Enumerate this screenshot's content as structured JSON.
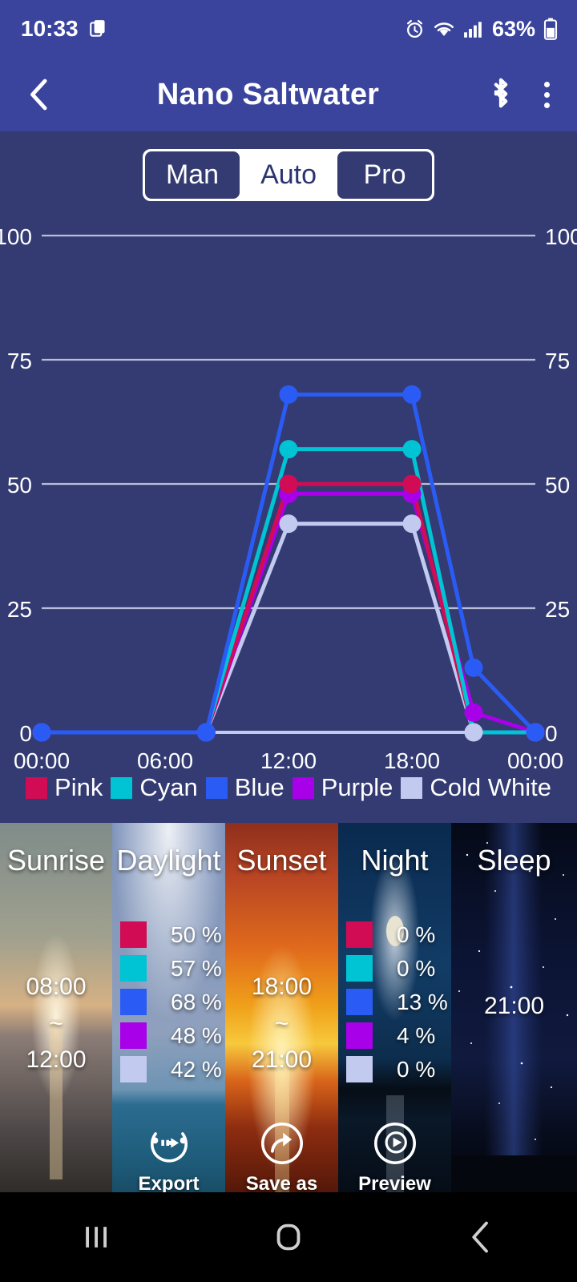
{
  "status_bar": {
    "time": "10:33",
    "battery_percent": "63%",
    "icons": [
      "screen-record-icon",
      "alarm-icon",
      "wifi-icon",
      "signal-icon",
      "battery-icon"
    ]
  },
  "app_bar": {
    "title": "Nano Saltwater",
    "back_icon": "back-chevron-icon",
    "bluetooth_icon": "bluetooth-icon",
    "overflow_icon": "kebab-menu-icon"
  },
  "mode_selector": {
    "options": [
      "Man",
      "Auto",
      "Pro"
    ],
    "selected": "Auto"
  },
  "colors": {
    "panel_bg": "#333b72",
    "app_bar_bg": "#3a449c",
    "pink": "#d10c54",
    "cyan": "#00c3d4",
    "blue": "#2a5cf5",
    "purple": "#a800e8",
    "cold_white": "#c3caf0",
    "grid": "#b9bed8",
    "axis_text": "#ffffff"
  },
  "chart_data": {
    "type": "line",
    "title": "",
    "xlabel": "",
    "ylabel": "",
    "ylim": [
      0,
      100
    ],
    "yticks": [
      0,
      25,
      50,
      75,
      100
    ],
    "ytick_labels_left": [
      "0",
      "25",
      "50",
      "75",
      "100"
    ],
    "ytick_labels_right": [
      "0",
      "25",
      "50",
      "75",
      "100"
    ],
    "xticks": [
      "00:00",
      "06:00",
      "12:00",
      "18:00",
      "00:00"
    ],
    "xlim_hours": [
      0,
      24
    ],
    "grid": true,
    "legend_position": "bottom",
    "x_points_hours": [
      0,
      8,
      12,
      18,
      21,
      24
    ],
    "series": [
      {
        "name": "Pink",
        "color": "#d10c54",
        "values": [
          0,
          0,
          50,
          50,
          0,
          0
        ]
      },
      {
        "name": "Cyan",
        "color": "#00c3d4",
        "values": [
          0,
          0,
          57,
          57,
          0,
          0
        ]
      },
      {
        "name": "Blue",
        "color": "#2a5cf5",
        "values": [
          0,
          0,
          68,
          68,
          13,
          0
        ]
      },
      {
        "name": "Purple",
        "color": "#a800e8",
        "values": [
          0,
          0,
          48,
          48,
          4,
          0
        ]
      },
      {
        "name": "Cold White",
        "color": "#c3caf0",
        "values": [
          0,
          0,
          42,
          42,
          0,
          0
        ]
      }
    ]
  },
  "legend": [
    {
      "label": "Pink",
      "color": "#d10c54"
    },
    {
      "label": "Cyan",
      "color": "#00c3d4"
    },
    {
      "label": "Blue",
      "color": "#2a5cf5"
    },
    {
      "label": "Purple",
      "color": "#a800e8"
    },
    {
      "label": "Cold White",
      "color": "#c3caf0"
    }
  ],
  "cards": [
    {
      "title": "Sunrise",
      "time_start": "08:00",
      "time_sep": "~",
      "time_end": "12:00",
      "values": []
    },
    {
      "title": "Daylight",
      "values": [
        {
          "color": "#d10c54",
          "text": "50 %"
        },
        {
          "color": "#00c3d4",
          "text": "57 %"
        },
        {
          "color": "#2a5cf5",
          "text": "68 %"
        },
        {
          "color": "#a800e8",
          "text": "48 %"
        },
        {
          "color": "#c3caf0",
          "text": "42 %"
        }
      ],
      "action": {
        "label": "Export",
        "icon": "export-cycle-icon"
      }
    },
    {
      "title": "Sunset",
      "time_start": "18:00",
      "time_sep": "~",
      "time_end": "21:00",
      "values": [],
      "action": {
        "label": "Save as",
        "icon": "share-arrow-icon"
      }
    },
    {
      "title": "Night",
      "values": [
        {
          "color": "#d10c54",
          "text": "0 %"
        },
        {
          "color": "#00c3d4",
          "text": "0 %"
        },
        {
          "color": "#2a5cf5",
          "text": "13 %"
        },
        {
          "color": "#a800e8",
          "text": "4 %"
        },
        {
          "color": "#c3caf0",
          "text": "0 %"
        }
      ],
      "action": {
        "label": "Preview",
        "icon": "play-circle-icon"
      }
    },
    {
      "title": "Sleep",
      "time_single": "21:00",
      "values": []
    }
  ],
  "nav_bar": {
    "recents_icon": "recents-icon",
    "home_icon": "home-icon",
    "back_icon": "nav-back-icon"
  }
}
